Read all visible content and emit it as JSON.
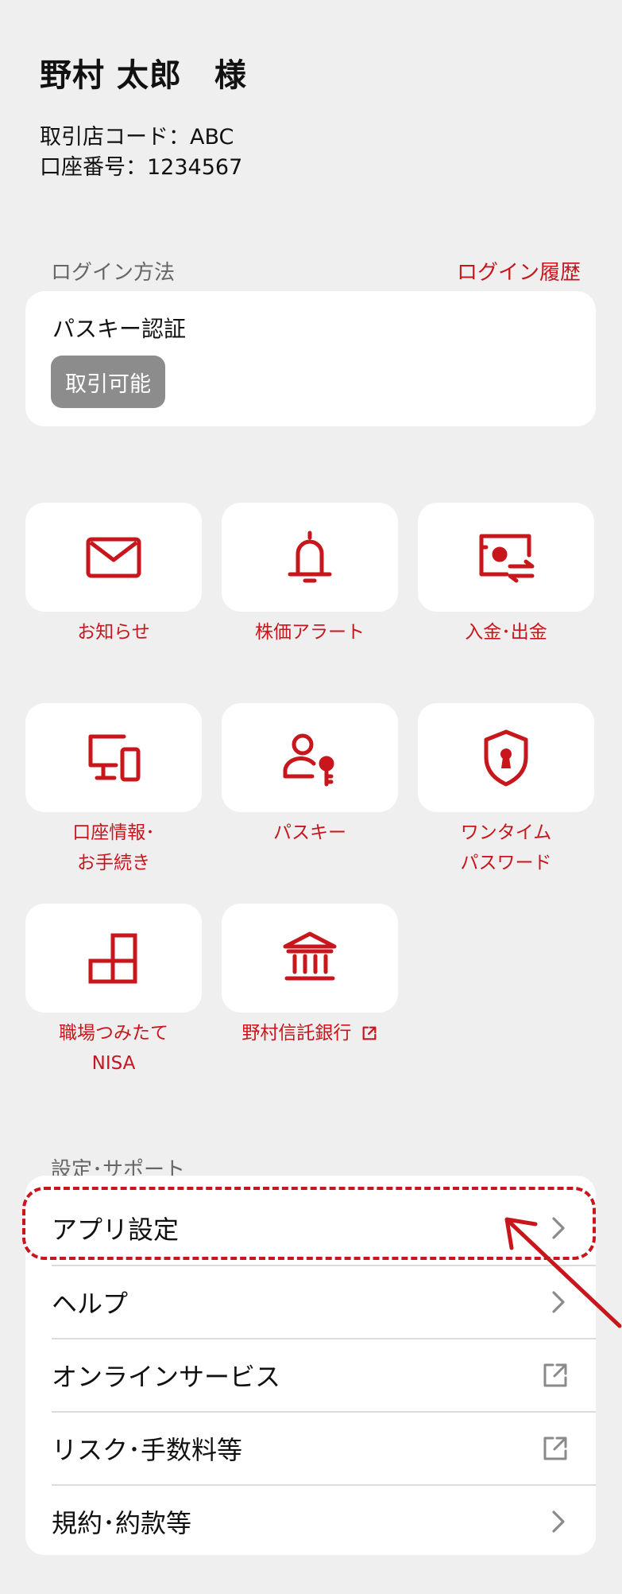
{
  "user": {
    "name": "野村 太郎　様",
    "branch_code": "取引店コード：ABC",
    "account_number": "口座番号：1234567"
  },
  "login": {
    "section_label": "ログイン方法",
    "history_link": "ログイン履歴",
    "method": "パスキー認証",
    "status_badge": "取引可能"
  },
  "menu_tiles": [
    {
      "icon": "mail-icon",
      "label_lines": [
        "お知らせ"
      ]
    },
    {
      "icon": "bell-icon",
      "label_lines": [
        "株価アラート"
      ]
    },
    {
      "icon": "deposit-withdraw-icon",
      "label_lines": [
        "入金･出金"
      ]
    },
    {
      "icon": "devices-icon",
      "label_lines": [
        "口座情報･",
        "お手続き"
      ]
    },
    {
      "icon": "user-key-icon",
      "label_lines": [
        "パスキー"
      ]
    },
    {
      "icon": "shield-lock-icon",
      "label_lines": [
        "ワンタイム",
        "パスワード"
      ]
    },
    {
      "icon": "blocks-icon",
      "label_lines": [
        "職場つみたて",
        "NISA"
      ]
    },
    {
      "icon": "bank-icon",
      "label_lines": [
        "野村信託銀行"
      ],
      "external": true
    }
  ],
  "settings": {
    "section_label": "設定･サポート",
    "items": [
      {
        "label": "アプリ設定",
        "icon": "chevron-right-icon"
      },
      {
        "label": "ヘルプ",
        "icon": "chevron-right-icon"
      },
      {
        "label": "オンラインサービス",
        "icon": "external-link-icon"
      },
      {
        "label": "リスク･手数料等",
        "icon": "external-link-icon"
      },
      {
        "label": "規約･約款等",
        "icon": "chevron-right-icon"
      }
    ]
  },
  "colors": {
    "accent": "#c8161d",
    "background": "#efefef",
    "card": "#ffffff",
    "badge": "#8c8c8c"
  }
}
